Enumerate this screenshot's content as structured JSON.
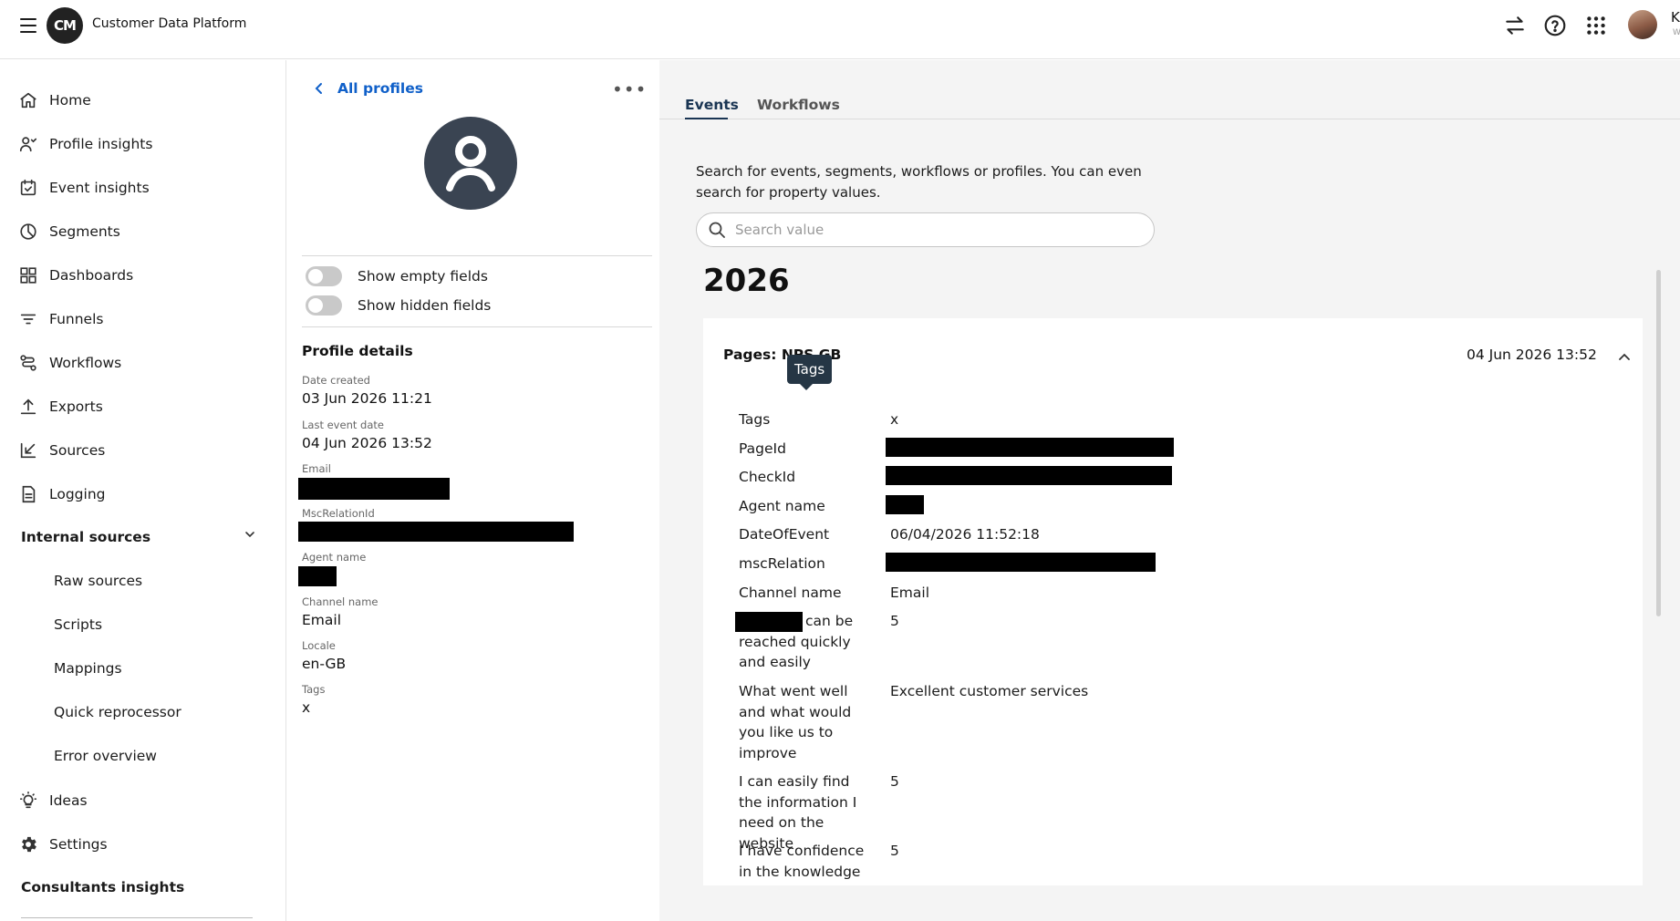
{
  "header": {
    "app_title": "Customer Data Platform",
    "logo_text": "CM",
    "user_initial": "K",
    "user_sub": "W",
    "icons": [
      "swap-icon",
      "help-icon",
      "apps-grid-icon",
      "user-avatar"
    ]
  },
  "sidebar": {
    "items": [
      {
        "label": "Home",
        "icon": "home-icon"
      },
      {
        "label": "Profile insights",
        "icon": "profile-insights-icon"
      },
      {
        "label": "Event insights",
        "icon": "calendar-check-icon"
      },
      {
        "label": "Segments",
        "icon": "pie-icon"
      },
      {
        "label": "Dashboards",
        "icon": "dashboard-grid-icon"
      },
      {
        "label": "Funnels",
        "icon": "funnel-icon"
      },
      {
        "label": "Workflows",
        "icon": "workflow-icon"
      },
      {
        "label": "Exports",
        "icon": "upload-icon"
      },
      {
        "label": "Sources",
        "icon": "import-icon"
      },
      {
        "label": "Logging",
        "icon": "document-icon"
      }
    ],
    "section_internal": "Internal sources",
    "sub_items": [
      "Raw sources",
      "Scripts",
      "Mappings",
      "Quick reprocessor",
      "Error overview"
    ],
    "bottom_items": [
      {
        "label": "Ideas",
        "icon": "lightbulb-icon"
      },
      {
        "label": "Settings",
        "icon": "gear-icon"
      }
    ],
    "section_consultants": "Consultants insights"
  },
  "profile": {
    "back_label": "All profiles",
    "more_label": "•••",
    "toggles": [
      {
        "label": "Show empty fields",
        "on": false
      },
      {
        "label": "Show hidden fields",
        "on": false
      }
    ],
    "details_title": "Profile details",
    "fields": [
      {
        "label": "Date created",
        "value": "03 Jun 2026 11:21"
      },
      {
        "label": "Last event date",
        "value": "04 Jun 2026 13:52"
      },
      {
        "label": "Email",
        "value": ""
      },
      {
        "label": "MscRelationId",
        "value": ""
      },
      {
        "label": "Agent name",
        "value": ""
      },
      {
        "label": "Channel name",
        "value": "Email"
      },
      {
        "label": "Locale",
        "value": "en-GB"
      },
      {
        "label": "Tags",
        "value": "x"
      }
    ]
  },
  "main": {
    "tabs": [
      {
        "label": "Events",
        "active": true
      },
      {
        "label": "Workflows",
        "active": false
      }
    ],
    "help_text": "Search for events, segments, workflows or profiles. You can even search for property values.",
    "search_placeholder": "Search value",
    "year": "2026",
    "event": {
      "title": "Pages: NPS GB",
      "date": "04 Jun 2026 13:52",
      "tooltip": "Tags",
      "properties": [
        {
          "key": "Tags",
          "value": "x"
        },
        {
          "key": "PageId",
          "value": ""
        },
        {
          "key": "CheckId",
          "value": ""
        },
        {
          "key": "Agent name",
          "value": ""
        },
        {
          "key": "DateOfEvent",
          "value": "06/04/2026 11:52:18"
        },
        {
          "key": "mscRelation",
          "value": ""
        },
        {
          "key": "Channel name",
          "value": "Email"
        },
        {
          "key": "can be reached quickly and easily",
          "value": "5"
        },
        {
          "key": "What went well and what would you like us to improve",
          "value": "Excellent customer services"
        },
        {
          "key": "I can easily find the information I need on the website",
          "value": "5"
        },
        {
          "key": "I have confidence in the knowledge of",
          "value": "5"
        }
      ]
    }
  },
  "colors": {
    "link_blue": "#1060c9",
    "tab_active": "#1a3553",
    "tooltip_bg": "#253645",
    "main_bg": "#f4f4f4"
  }
}
